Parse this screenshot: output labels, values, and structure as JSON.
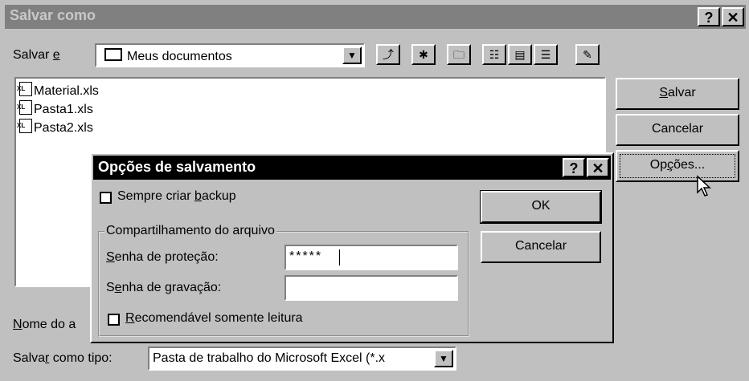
{
  "main_window": {
    "title": "Salvar como",
    "help_label": "?",
    "close_label": "✕",
    "save_in_prefix": "Salvar ",
    "save_in_accel": "e",
    "location": "Meus documentos",
    "files": [
      "Material.xls",
      "Pasta1.xls",
      "Pasta2.xls"
    ],
    "buttons": {
      "save_accel": "S",
      "save_rest": "alvar",
      "cancel": "Cancelar",
      "options_prefix": "Op",
      "options_accel": "ç",
      "options_rest": "ões..."
    },
    "filename_label_accel": "N",
    "filename_label_rest": "ome do a",
    "savetype_label_prefix": "Salva",
    "savetype_label_accel": "r",
    "savetype_label_rest": " como tipo:",
    "savetype_value": "Pasta de trabalho do Microsoft Excel (*.x"
  },
  "options_dialog": {
    "title": "Opções de salvamento",
    "help_label": "?",
    "close_label": "✕",
    "backup_prefix": "Sempre criar ",
    "backup_accel": "b",
    "backup_rest": "ackup",
    "ok_label": "OK",
    "cancel_label": "Cancelar",
    "group_title": "Compartilhamento do arquivo",
    "protection_label_accel": "S",
    "protection_label_rest": "enha de proteção:",
    "protection_value": "*****",
    "write_label_prefix": "S",
    "write_label_accel": "e",
    "write_label_rest": "nha de gravação:",
    "write_value": "",
    "readonly_accel": "R",
    "readonly_rest": "ecomendável somente leitura"
  }
}
